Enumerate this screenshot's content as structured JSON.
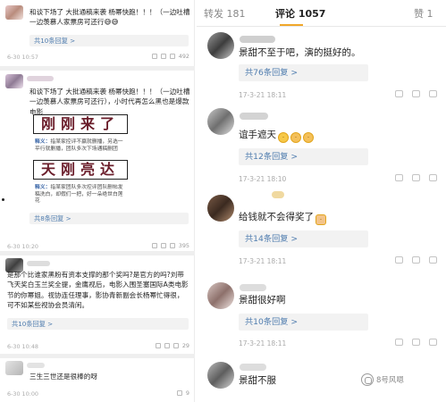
{
  "left": {
    "comments": [
      {
        "text": "和谈下场了 大批通稿来袭 杨幂快跑！！！（一边吐槽一边羡慕人家票房可还行😅😅",
        "replies": "共10条回复 >",
        "time": "6-30 10:57",
        "likes": "492"
      },
      {
        "text": "和谈下场了 大批通稿来袭 杨幂快跑！！！（一边吐槽一边羡慕人家票房可还行），小时代再怎么黑也是爆款电影",
        "meme_top": {
          "big": "刚刚来了",
          "caption_label": "释义：",
          "caption": "指某家控评不赢就删播，另选一平行就删播，团队多次下场通稿删团"
        },
        "meme_bottom": {
          "big": "天刚亮达",
          "caption_label": "释义：",
          "caption": "指某家团队多次控评团队删帖发稿洗白，却假们一把，好一朵绝世白莲花"
        },
        "replies": "共8条回复 >",
        "time": "6-30 10:20",
        "likes": "395"
      },
      {
        "text": "是那个比谁家黑粉有资本支撑的那个奖吗?是官方的吗?刘带飞天奖白玉兰奖全提，金鹰视后，电影入围圣塞国际A类电影节的你幂姐。视协连任理事，影协青新副会长杨幂忙得很，可不如某些视协会员清闲。",
        "replies": "共10条回复 >",
        "time": "6-30 10:48",
        "likes": "29"
      },
      {
        "text": "三生三世还是很棒的呀",
        "time": "6-30 10:00",
        "likes": "9"
      }
    ]
  },
  "right": {
    "tabs": {
      "repost": "转发 181",
      "comments": "评论 1057",
      "likes": "赞 1"
    },
    "comments": [
      {
        "text": "景甜不至于吧，演的挺好的。",
        "replies": "共76条回复 >",
        "time": "17-3-21 18:11"
      },
      {
        "text": "谊手遮天",
        "replies": "共12条回复 >",
        "time": "17-3-21 18:10"
      },
      {
        "text": "给钱就不会得奖了",
        "replies": "共14条回复 >",
        "time": "17-3-21 18:11"
      },
      {
        "text": "景甜很好啊",
        "replies": "共10条回复 >",
        "time": "17-3-21 18:11"
      },
      {
        "text": "景甜不服",
        "time": ""
      }
    ]
  },
  "watermark": "8号风嗯",
  "colors": {
    "link": "#507daf",
    "tab_indicator": "#f0a72a",
    "meme_text": "#6a1d2a"
  }
}
